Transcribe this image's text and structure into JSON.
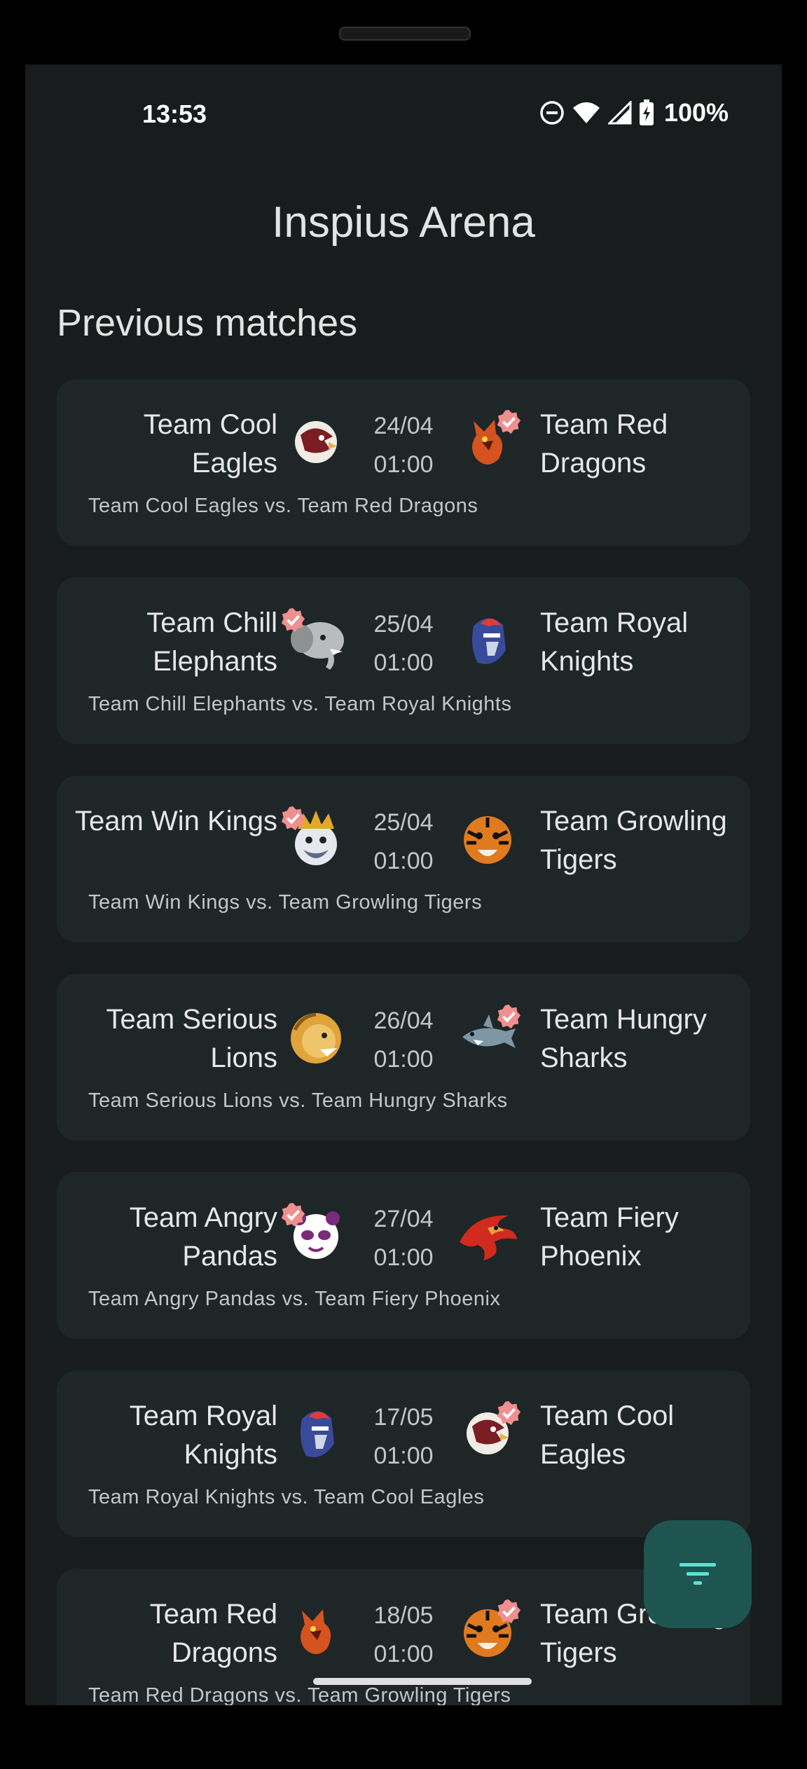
{
  "status": {
    "time": "13:53",
    "battery": "100%"
  },
  "app": {
    "title": "Inspius Arena"
  },
  "section": {
    "title": "Previous matches"
  },
  "matches": [
    {
      "home": "Team Cool Eagles",
      "away": "Team Red Dragons",
      "date": "24/04",
      "time": "01:00",
      "desc": "Team Cool Eagles vs. Team Red Dragons",
      "home_icon": "eagle-logo-icon",
      "away_icon": "dragon-logo-icon",
      "winner": "away"
    },
    {
      "home": "Team Chill Elephants",
      "away": "Team Royal Knights",
      "date": "25/04",
      "time": "01:00",
      "desc": "Team Chill Elephants vs. Team Royal Knights",
      "home_icon": "elephant-logo-icon",
      "away_icon": "knight-logo-icon",
      "winner": "home"
    },
    {
      "home": "Team Win Kings",
      "away": "Team Growling Tigers",
      "date": "25/04",
      "time": "01:00",
      "desc": "Team Win Kings vs. Team Growling Tigers",
      "home_icon": "king-logo-icon",
      "away_icon": "tiger-logo-icon",
      "winner": "home"
    },
    {
      "home": "Team Serious Lions",
      "away": "Team Hungry Sharks",
      "date": "26/04",
      "time": "01:00",
      "desc": "Team Serious Lions vs. Team Hungry Sharks",
      "home_icon": "lion-logo-icon",
      "away_icon": "shark-logo-icon",
      "winner": "away"
    },
    {
      "home": "Team Angry Pandas",
      "away": "Team Fiery Phoenix",
      "date": "27/04",
      "time": "01:00",
      "desc": "Team Angry Pandas vs. Team Fiery Phoenix",
      "home_icon": "panda-logo-icon",
      "away_icon": "phoenix-logo-icon",
      "winner": "home"
    },
    {
      "home": "Team Royal Knights",
      "away": "Team Cool Eagles",
      "date": "17/05",
      "time": "01:00",
      "desc": "Team Royal Knights vs. Team Cool Eagles",
      "home_icon": "knight-logo-icon",
      "away_icon": "eagle-logo-icon",
      "winner": "away"
    },
    {
      "home": "Team Red Dragons",
      "away": "Team Growling Tigers",
      "date": "18/05",
      "time": "01:00",
      "desc": "Team Red Dragons vs. Team Growling Tigers",
      "home_icon": "dragon-logo-icon",
      "away_icon": "tiger-logo-icon",
      "winner": "away"
    }
  ],
  "fab": {
    "icon": "filter-icon"
  },
  "colors": {
    "background": "#191c1c",
    "card": "#1e2627",
    "fab": "#1e5550",
    "accent": "#5ce1d4",
    "badge": "#f08f8f"
  }
}
